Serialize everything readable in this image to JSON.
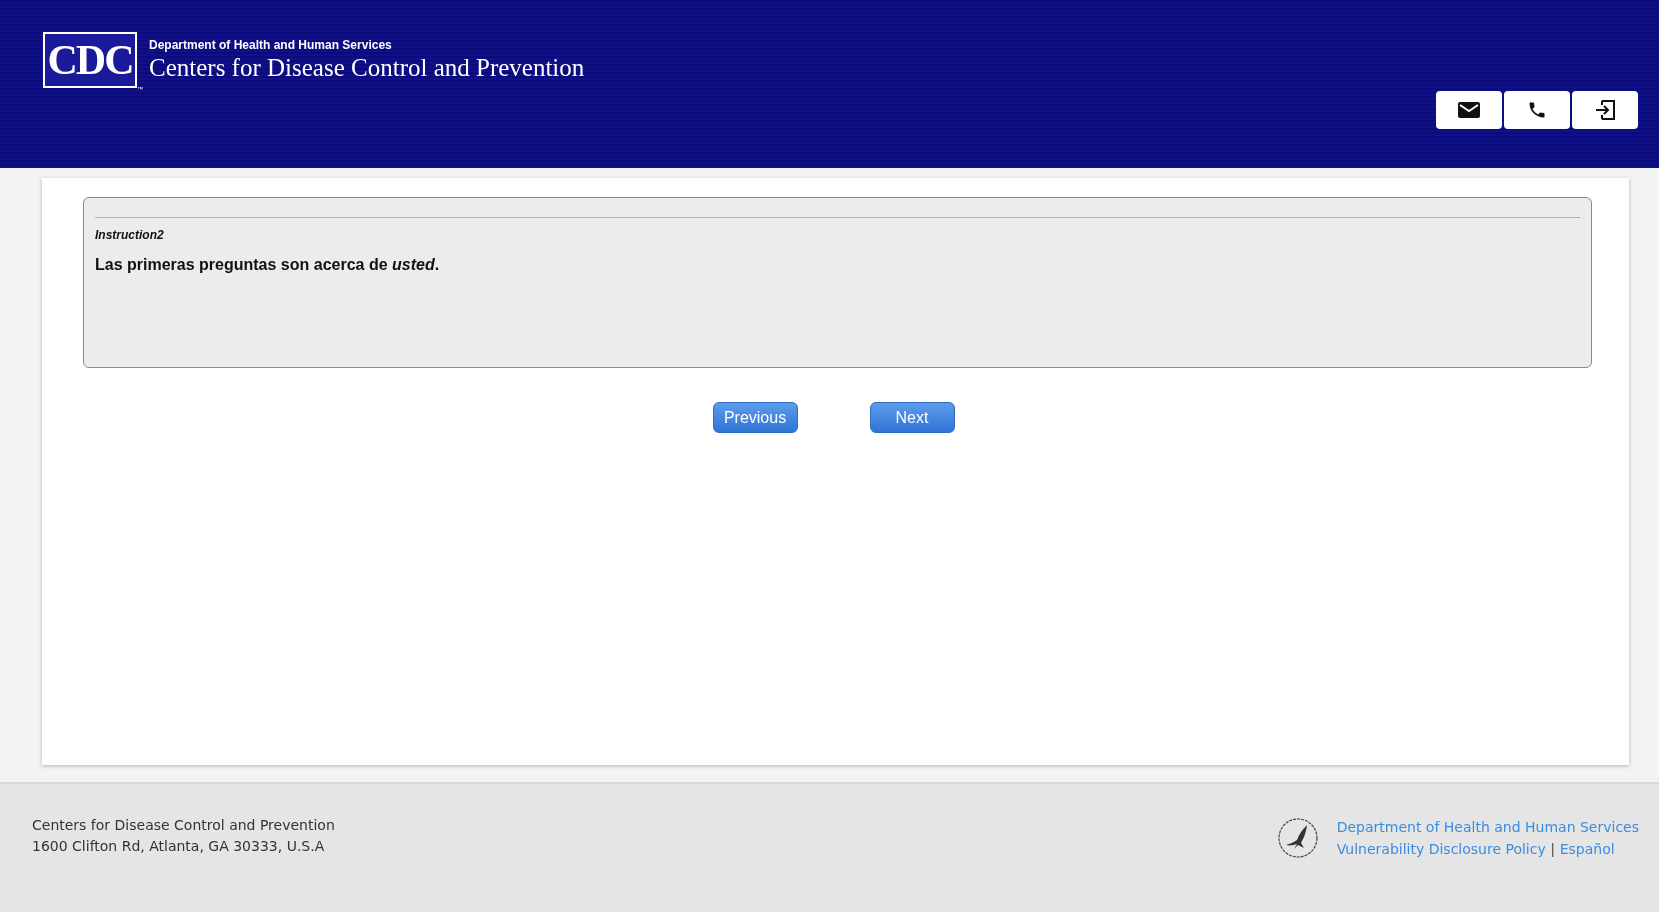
{
  "header": {
    "logo_text": "CDC",
    "logo_mark": "™",
    "department": "Department of Health and Human Services",
    "agency": "Centers for Disease Control and Prevention",
    "actions": [
      {
        "kind": "mail"
      },
      {
        "kind": "phone"
      },
      {
        "kind": "exit"
      }
    ]
  },
  "question": {
    "label": "Instruction2",
    "text": "Las primeras preguntas son acerca de *usted*."
  },
  "buttons": [
    "Previous",
    "Next"
  ],
  "footer": {
    "address_lines": [
      "Centers for Disease Control and Prevention",
      "1600 Clifton Rd, Atlanta, GA 30333, U.S.A"
    ],
    "links": [
      "Department of Health and Human Services",
      "Vulnerability Disclosure Policy",
      "Español"
    ],
    "separator": "|"
  }
}
